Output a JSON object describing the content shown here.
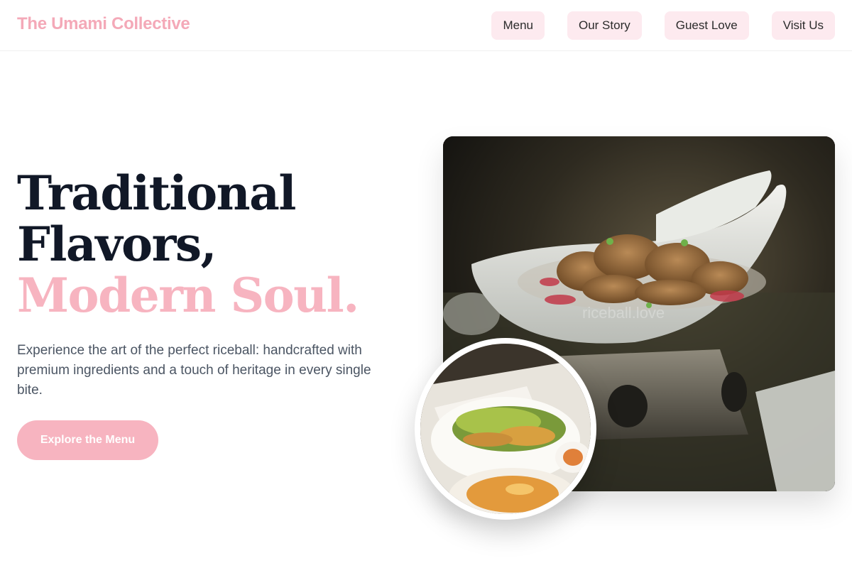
{
  "header": {
    "brand": "The Umami Collective",
    "nav": [
      "Menu",
      "Our Story",
      "Guest Love",
      "Visit Us"
    ]
  },
  "hero": {
    "headline_line1": "Traditional",
    "headline_line2": "Flavors,",
    "headline_accent": "Modern Soul.",
    "subtext": "Experience the art of the perfect riceball: handcrafted with premium ingredients and a touch of heritage in every single bite.",
    "cta": "Explore the Menu"
  },
  "images": {
    "main_watermark": "riceball.love"
  },
  "colors": {
    "accent": "#f7b4c0",
    "brand": "#f4a9b8",
    "nav_bg": "#fdeaef",
    "headline": "#111827",
    "body_text": "#4b5563"
  }
}
